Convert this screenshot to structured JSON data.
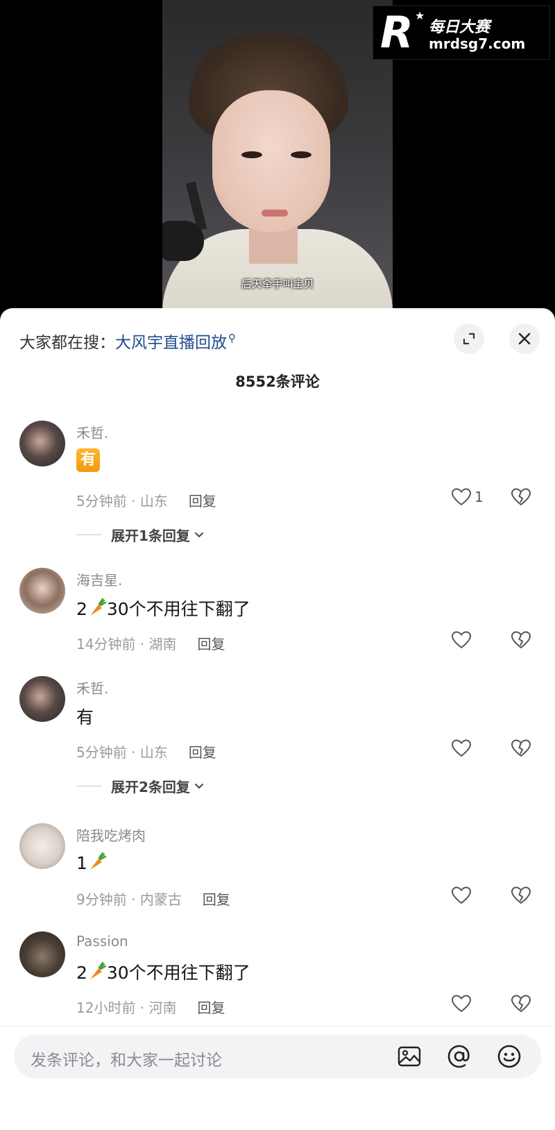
{
  "video": {
    "subtitle": "后天牵手叫宝贝"
  },
  "watermark": {
    "logo": "R",
    "name": "每日大赛",
    "url": "mrdsg7.com"
  },
  "sheet": {
    "search_prefix": "大家都在搜：",
    "search_term": "大风宇直播回放",
    "comment_count": "8552条评论"
  },
  "comments": [
    {
      "username": "禾哲.",
      "content": "有",
      "content_style": "badge",
      "time": "5分钟前",
      "location": "山东",
      "reply_label": "回复",
      "likes": "1",
      "expand_label": "展开1条回复"
    },
    {
      "username": "海吉星.",
      "content_pre": "2",
      "content_post": "30个不用往下翻了",
      "time": "14分钟前",
      "location": "湖南",
      "reply_label": "回复",
      "likes": ""
    },
    {
      "username": "禾哲.",
      "content": "有",
      "time": "5分钟前",
      "location": "山东",
      "reply_label": "回复",
      "likes": "",
      "expand_label": "展开2条回复"
    },
    {
      "username": "陪我吃烤肉",
      "content_pre": "1",
      "content_post": "",
      "time": "9分钟前",
      "location": "内蒙古",
      "reply_label": "回复",
      "likes": ""
    },
    {
      "username": "Passion",
      "content_pre": "2",
      "content_post": "30个不用往下翻了",
      "time": "12小时前",
      "location": "河南",
      "reply_label": "回复",
      "likes": ""
    }
  ],
  "input": {
    "placeholder": "发条评论，和大家一起讨论"
  },
  "icons": {
    "expand": "expand-icon",
    "close": "close-icon",
    "like": "heart-icon",
    "dislike": "broken-heart-icon",
    "carrot": "carrot-icon",
    "image": "image-icon",
    "at": "at-icon",
    "emoji": "emoji-icon"
  },
  "colors": {
    "search_term": "#1f4b8c",
    "badge": "#f39a10",
    "sheet_bg": "#ffffff",
    "input_bg": "#f3f3f5"
  }
}
